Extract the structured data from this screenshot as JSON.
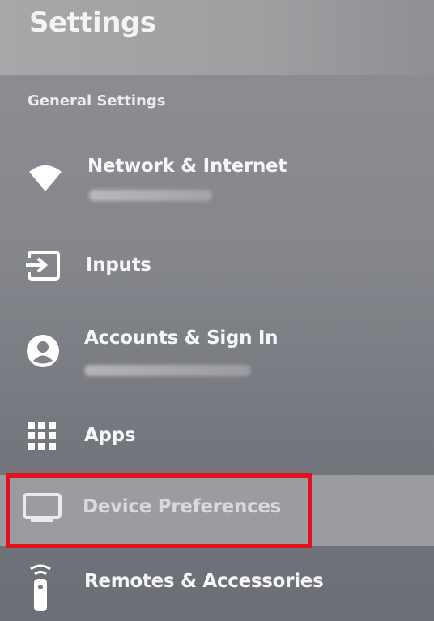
{
  "header": {
    "title": "Settings"
  },
  "section": {
    "title": "General Settings"
  },
  "menu": {
    "items": [
      {
        "label": "Network & Internet",
        "icon": "wifi-icon",
        "has_sub": true
      },
      {
        "label": "Inputs",
        "icon": "input-icon",
        "has_sub": false
      },
      {
        "label": "Accounts & Sign In",
        "icon": "account-icon",
        "has_sub": true
      },
      {
        "label": "Apps",
        "icon": "apps-grid-icon",
        "has_sub": false
      },
      {
        "label": "Device Preferences",
        "icon": "tv-icon",
        "selected": true
      },
      {
        "label": "Remotes & Accessories",
        "icon": "remote-icon",
        "has_sub": false
      }
    ]
  },
  "colors": {
    "highlight": "#e0121b",
    "selected_row": "#9b9ca1",
    "text": "#f6f6f8"
  }
}
